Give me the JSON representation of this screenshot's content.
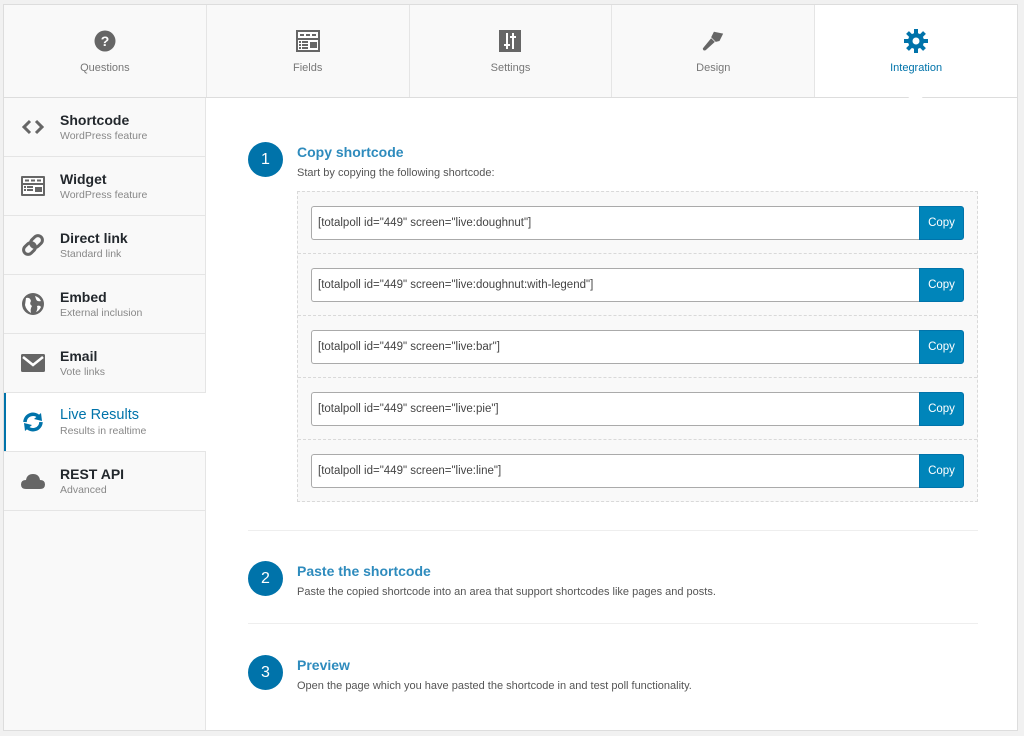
{
  "tabs": [
    {
      "label": "Questions",
      "icon": "question-circle-icon"
    },
    {
      "label": "Fields",
      "icon": "fields-form-icon"
    },
    {
      "label": "Settings",
      "icon": "sliders-icon"
    },
    {
      "label": "Design",
      "icon": "paintbrush-icon"
    },
    {
      "label": "Integration",
      "icon": "gear-icon",
      "active": true
    }
  ],
  "sidebar": {
    "items": [
      {
        "title": "Shortcode",
        "subtitle": "WordPress feature",
        "icon": "code-brackets-icon"
      },
      {
        "title": "Widget",
        "subtitle": "WordPress feature",
        "icon": "widget-icon"
      },
      {
        "title": "Direct link",
        "subtitle": "Standard link",
        "icon": "link-icon"
      },
      {
        "title": "Embed",
        "subtitle": "External inclusion",
        "icon": "globe-icon"
      },
      {
        "title": "Email",
        "subtitle": "Vote links",
        "icon": "envelope-icon"
      },
      {
        "title": "Live Results",
        "subtitle": "Results in realtime",
        "icon": "refresh-icon",
        "active": true
      },
      {
        "title": "REST API",
        "subtitle": "Advanced",
        "icon": "cloud-icon"
      }
    ]
  },
  "steps": [
    {
      "number": "1",
      "title": "Copy shortcode",
      "description": "Start by copying the following shortcode:"
    },
    {
      "number": "2",
      "title": "Paste the shortcode",
      "description": "Paste the copied shortcode into an area that support shortcodes like pages and posts."
    },
    {
      "number": "3",
      "title": "Preview",
      "description": "Open the page which you have pasted the shortcode in and test poll functionality."
    }
  ],
  "shortcodes": [
    {
      "value": "[totalpoll id=\"449\" screen=\"live:doughnut\"]",
      "button": "Copy"
    },
    {
      "value": "[totalpoll id=\"449\" screen=\"live:doughnut:with-legend\"]",
      "button": "Copy"
    },
    {
      "value": "[totalpoll id=\"449\" screen=\"live:bar\"]",
      "button": "Copy"
    },
    {
      "value": "[totalpoll id=\"449\" screen=\"live:pie\"]",
      "button": "Copy"
    },
    {
      "value": "[totalpoll id=\"449\" screen=\"live:line\"]",
      "button": "Copy"
    }
  ],
  "colors": {
    "accent": "#0073aa",
    "button": "#0085ba",
    "icon_gray": "#666666"
  }
}
